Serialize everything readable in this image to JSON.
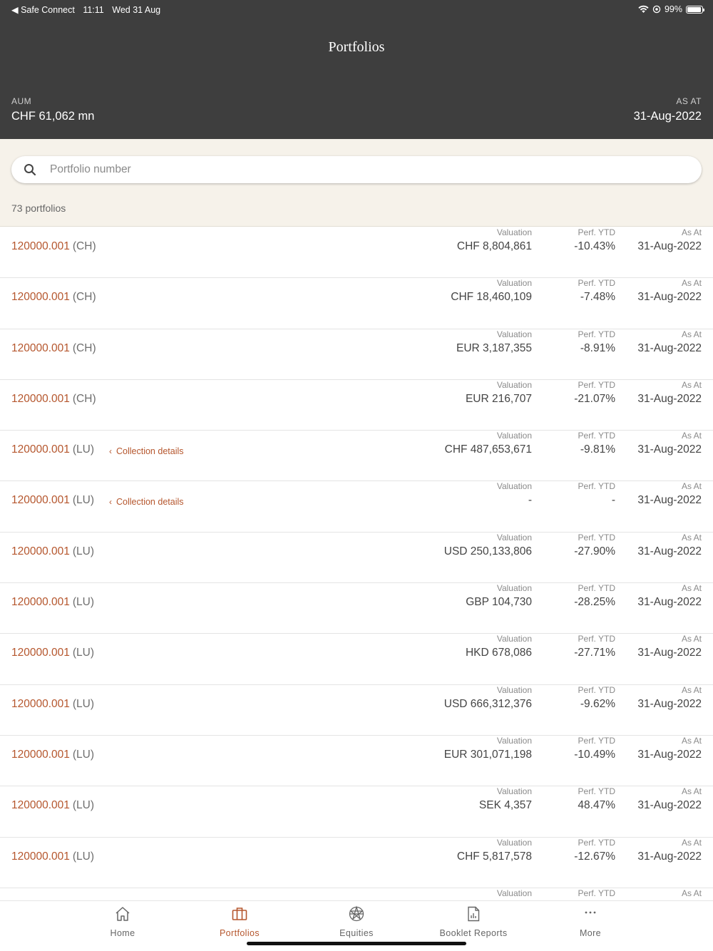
{
  "status_bar": {
    "carrier": "◀ Safe Connect",
    "time": "11:11",
    "date": "Wed 31 Aug",
    "battery": "99%"
  },
  "header": {
    "title": "Portfolios",
    "aum_label": "AUM",
    "aum_value": "CHF 61,062 mn",
    "asat_label": "AS AT",
    "asat_value": "31-Aug-2022"
  },
  "search": {
    "placeholder": "Portfolio number",
    "value": ""
  },
  "count_text": "73 portfolios",
  "columns": {
    "valuation": "Valuation",
    "perf": "Perf. YTD",
    "asat": "As At"
  },
  "collection_label": "Collection details",
  "rows": [
    {
      "id": "120000.001",
      "region": "(CH)",
      "valuation": "CHF 8,804,861",
      "perf": "-10.43%",
      "asat": "31-Aug-2022",
      "collection": false
    },
    {
      "id": "120000.001",
      "region": "(CH)",
      "valuation": "CHF 18,460,109",
      "perf": "-7.48%",
      "asat": "31-Aug-2022",
      "collection": false
    },
    {
      "id": "120000.001",
      "region": "(CH)",
      "valuation": "EUR 3,187,355",
      "perf": "-8.91%",
      "asat": "31-Aug-2022",
      "collection": false
    },
    {
      "id": "120000.001",
      "region": "(CH)",
      "valuation": "EUR 216,707",
      "perf": "-21.07%",
      "asat": "31-Aug-2022",
      "collection": false
    },
    {
      "id": "120000.001",
      "region": "(LU)",
      "valuation": "CHF 487,653,671",
      "perf": "-9.81%",
      "asat": "31-Aug-2022",
      "collection": true
    },
    {
      "id": "120000.001",
      "region": "(LU)",
      "valuation": "-",
      "perf": "-",
      "asat": "31-Aug-2022",
      "collection": true
    },
    {
      "id": "120000.001",
      "region": "(LU)",
      "valuation": "USD 250,133,806",
      "perf": "-27.90%",
      "asat": "31-Aug-2022",
      "collection": false
    },
    {
      "id": "120000.001",
      "region": "(LU)",
      "valuation": "GBP 104,730",
      "perf": "-28.25%",
      "asat": "31-Aug-2022",
      "collection": false
    },
    {
      "id": "120000.001",
      "region": "(LU)",
      "valuation": "HKD 678,086",
      "perf": "-27.71%",
      "asat": "31-Aug-2022",
      "collection": false
    },
    {
      "id": "120000.001",
      "region": "(LU)",
      "valuation": "USD 666,312,376",
      "perf": "-9.62%",
      "asat": "31-Aug-2022",
      "collection": false
    },
    {
      "id": "120000.001",
      "region": "(LU)",
      "valuation": "EUR 301,071,198",
      "perf": "-10.49%",
      "asat": "31-Aug-2022",
      "collection": false
    },
    {
      "id": "120000.001",
      "region": "(LU)",
      "valuation": "SEK 4,357",
      "perf": "48.47%",
      "asat": "31-Aug-2022",
      "collection": false
    },
    {
      "id": "120000.001",
      "region": "(LU)",
      "valuation": "CHF 5,817,578",
      "perf": "-12.67%",
      "asat": "31-Aug-2022",
      "collection": false
    },
    {
      "id": "",
      "region": "",
      "valuation": "",
      "perf": "",
      "asat": "",
      "collection": false
    }
  ],
  "tabs": [
    {
      "label": "Home",
      "icon": "home-icon",
      "active": false
    },
    {
      "label": "Portfolios",
      "icon": "briefcase-icon",
      "active": true
    },
    {
      "label": "Equities",
      "icon": "globe-network-icon",
      "active": false
    },
    {
      "label": "Booklet Reports",
      "icon": "report-icon",
      "active": false
    },
    {
      "label": "More",
      "icon": "more-icon",
      "active": false
    }
  ],
  "colors": {
    "header_bg": "#3e3e3e",
    "accent": "#b5562d",
    "search_area_bg": "#f6f2ea"
  }
}
